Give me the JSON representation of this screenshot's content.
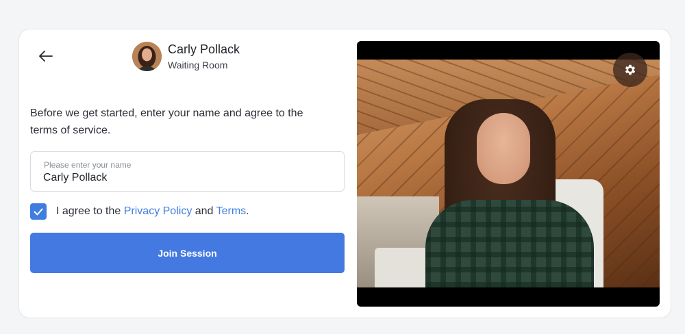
{
  "header": {
    "host_name": "Carly Pollack",
    "subtitle": "Waiting Room"
  },
  "form": {
    "intro": "Before we get started, enter your name and agree to the terms of service.",
    "name_placeholder": "Please enter your name",
    "name_value": "Carly Pollack",
    "agree_prefix": "I agree to the ",
    "privacy_link": "Privacy Policy",
    "agree_middle": " and ",
    "terms_link": "Terms",
    "agree_suffix": ".",
    "checkbox_checked": true,
    "join_label": "Join Session"
  },
  "icons": {
    "back": "arrow-left-icon",
    "checkbox": "check-icon",
    "settings": "gear-icon"
  },
  "colors": {
    "accent": "#4479e1",
    "link": "#3f7de0",
    "card_bg": "#ffffff",
    "page_bg": "#f4f5f7"
  }
}
